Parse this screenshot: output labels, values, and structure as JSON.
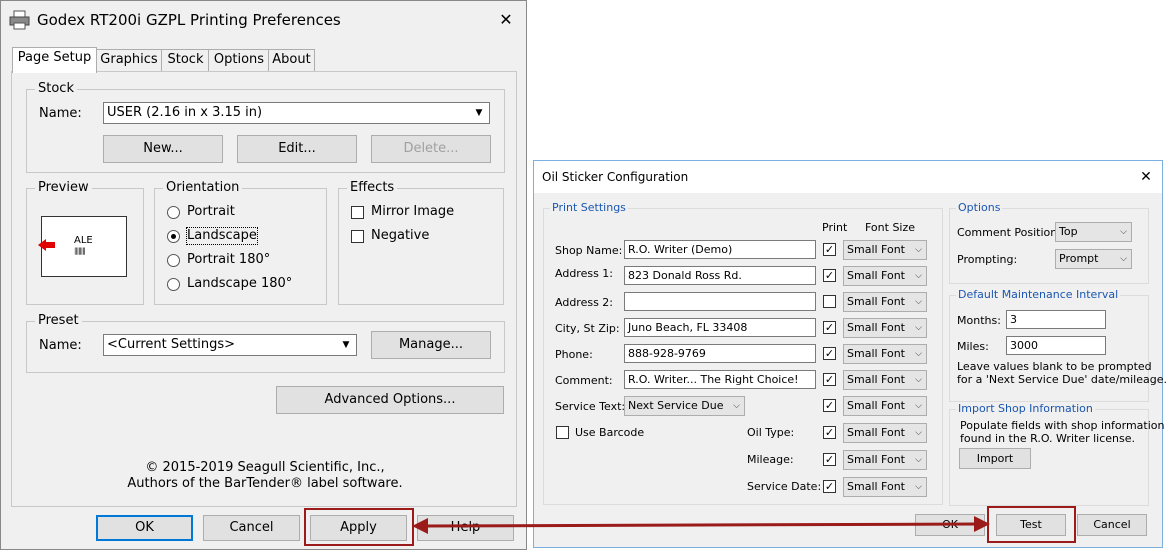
{
  "prefs": {
    "title": "Godex RT200i GZPL Printing Preferences",
    "close_glyph": "✕",
    "tabs": [
      "Page Setup",
      "Graphics",
      "Stock",
      "Options",
      "About"
    ],
    "stock": {
      "group": "Stock",
      "name_label": "Name:",
      "name_value": "USER (2.16 in x 3.15 in)",
      "new_btn": "New...",
      "edit_btn": "Edit...",
      "delete_btn": "Delete..."
    },
    "preview": {
      "group": "Preview",
      "sample_text": "ALE",
      "barcode": "||||||||"
    },
    "orientation": {
      "group": "Orientation",
      "options": [
        "Portrait",
        "Landscape",
        "Portrait 180°",
        "Landscape 180°"
      ],
      "selected": "Landscape"
    },
    "effects": {
      "group": "Effects",
      "options": [
        "Mirror Image",
        "Negative"
      ]
    },
    "preset": {
      "group": "Preset",
      "name_label": "Name:",
      "name_value": "<Current Settings>",
      "manage_btn": "Manage..."
    },
    "advanced_btn": "Advanced Options...",
    "copyright_line1": "© 2015-2019 Seagull Scientific, Inc.,",
    "copyright_line2": "Authors of the BarTender® label software.",
    "buttons": {
      "ok": "OK",
      "cancel": "Cancel",
      "apply": "Apply",
      "help": "Help"
    }
  },
  "oil": {
    "title": "Oil Sticker Configuration",
    "close_glyph": "✕",
    "print_settings": {
      "group": "Print Settings",
      "col_print": "Print",
      "col_font": "Font Size",
      "rows": [
        {
          "label": "Shop Name:",
          "value": "R.O. Writer (Demo)",
          "checked": true,
          "font": "Small Font"
        },
        {
          "label": "Address 1:",
          "value": "823 Donald Ross Rd.",
          "checked": true,
          "font": "Small Font"
        },
        {
          "label": "Address 2:",
          "value": "",
          "checked": false,
          "font": "Small Font"
        },
        {
          "label": "City, St Zip:",
          "value": "Juno Beach, FL 33408",
          "checked": true,
          "font": "Small Font"
        },
        {
          "label": "Phone:",
          "value": "888-928-9769",
          "checked": true,
          "font": "Small Font"
        },
        {
          "label": "Comment:",
          "value": "R.O. Writer... The Right Choice!",
          "checked": true,
          "font": "Small Font"
        }
      ],
      "service_text_label": "Service Text:",
      "service_text_value": "Next Service Due",
      "service_text_checked": true,
      "service_text_font": "Small Font",
      "use_barcode_label": "Use Barcode",
      "extra_rows": [
        {
          "label": "Oil Type:",
          "checked": true,
          "font": "Small Font"
        },
        {
          "label": "Mileage:",
          "checked": true,
          "font": "Small Font"
        },
        {
          "label": "Service Date:",
          "checked": true,
          "font": "Small Font"
        }
      ]
    },
    "options": {
      "group": "Options",
      "comment_position_label": "Comment Position:",
      "comment_position_value": "Top",
      "prompting_label": "Prompting:",
      "prompting_value": "Prompt"
    },
    "maintenance": {
      "group": "Default Maintenance Interval",
      "months_label": "Months:",
      "months_value": "3",
      "miles_label": "Miles:",
      "miles_value": "3000",
      "note_line1": "Leave values blank to be prompted",
      "note_line2": "for a 'Next Service Due' date/mileage."
    },
    "import": {
      "group": "Import Shop Information",
      "note_line1": "Populate fields with shop information",
      "note_line2": "found in the R.O. Writer license.",
      "button": "Import"
    },
    "buttons": {
      "ok": "OK",
      "test": "Test",
      "cancel": "Cancel"
    }
  },
  "annotation": {
    "color": "#9b1b1b"
  }
}
